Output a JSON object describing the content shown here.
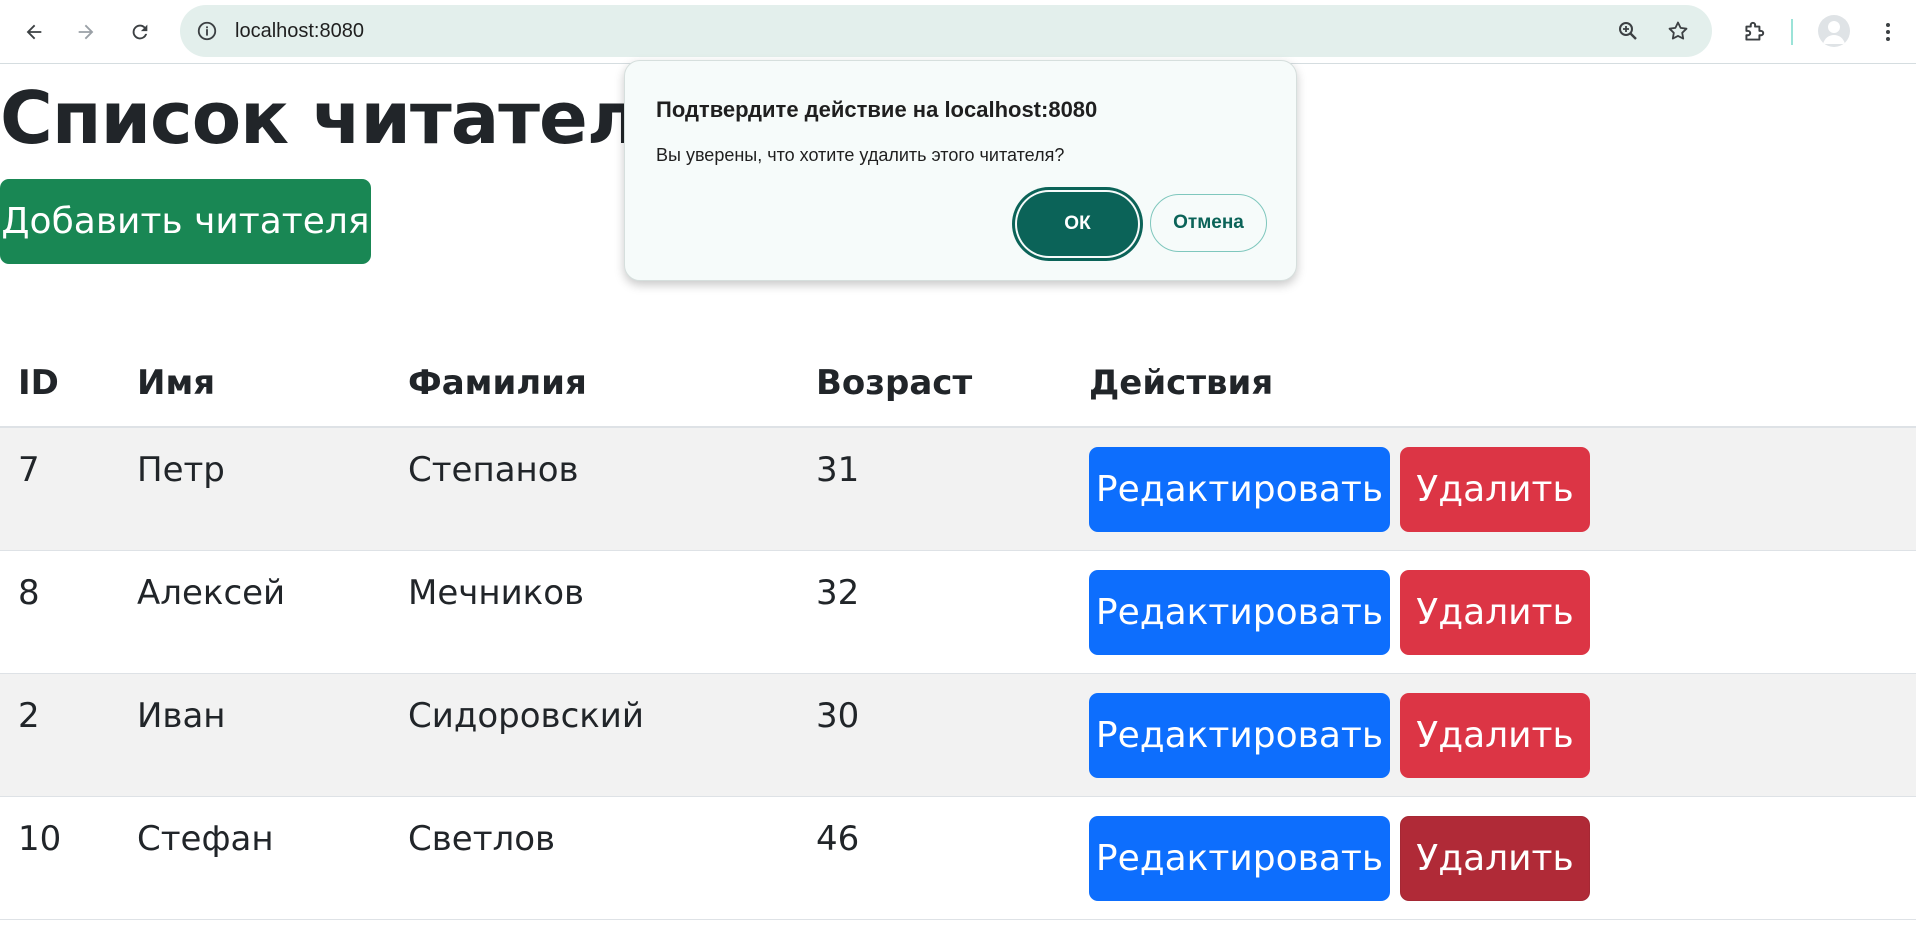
{
  "browser": {
    "url": "localhost:8080",
    "icons": [
      "back-arrow-icon",
      "forward-arrow-icon",
      "reload-icon",
      "site-info-icon",
      "zoom-icon",
      "bookmark-star-icon",
      "extensions-puzzle-icon",
      "profile-avatar-icon",
      "kebab-menu-icon"
    ]
  },
  "page": {
    "title": "Список читателей",
    "add_button_label": "Добавить читателя"
  },
  "table": {
    "headers": [
      "ID",
      "Имя",
      "Фамилия",
      "Возраст",
      "Действия"
    ],
    "rows": [
      {
        "id": "7",
        "first_name": "Петр",
        "last_name": "Степанов",
        "age": "31",
        "edit_label": "Редактировать",
        "delete_label": "Удалить"
      },
      {
        "id": "8",
        "first_name": "Алексей",
        "last_name": "Мечников",
        "age": "32",
        "edit_label": "Редактировать",
        "delete_label": "Удалить"
      },
      {
        "id": "2",
        "first_name": "Иван",
        "last_name": "Сидоровский",
        "age": "30",
        "edit_label": "Редактировать",
        "delete_label": "Удалить"
      },
      {
        "id": "10",
        "first_name": "Стефан",
        "last_name": "Светлов",
        "age": "46",
        "edit_label": "Редактировать",
        "delete_label": "Удалить"
      }
    ]
  },
  "dialog": {
    "title": "Подтвердите действие на localhost:8080",
    "message": "Вы уверены, что хотите удалить этого читателя?",
    "ok_label": "ОК",
    "cancel_label": "Отмена"
  },
  "colors": {
    "success": "#198754",
    "primary": "#0d6efd",
    "danger": "#dc3545",
    "danger_hover": "#b02a37",
    "dialog_accent": "#0b6358"
  }
}
